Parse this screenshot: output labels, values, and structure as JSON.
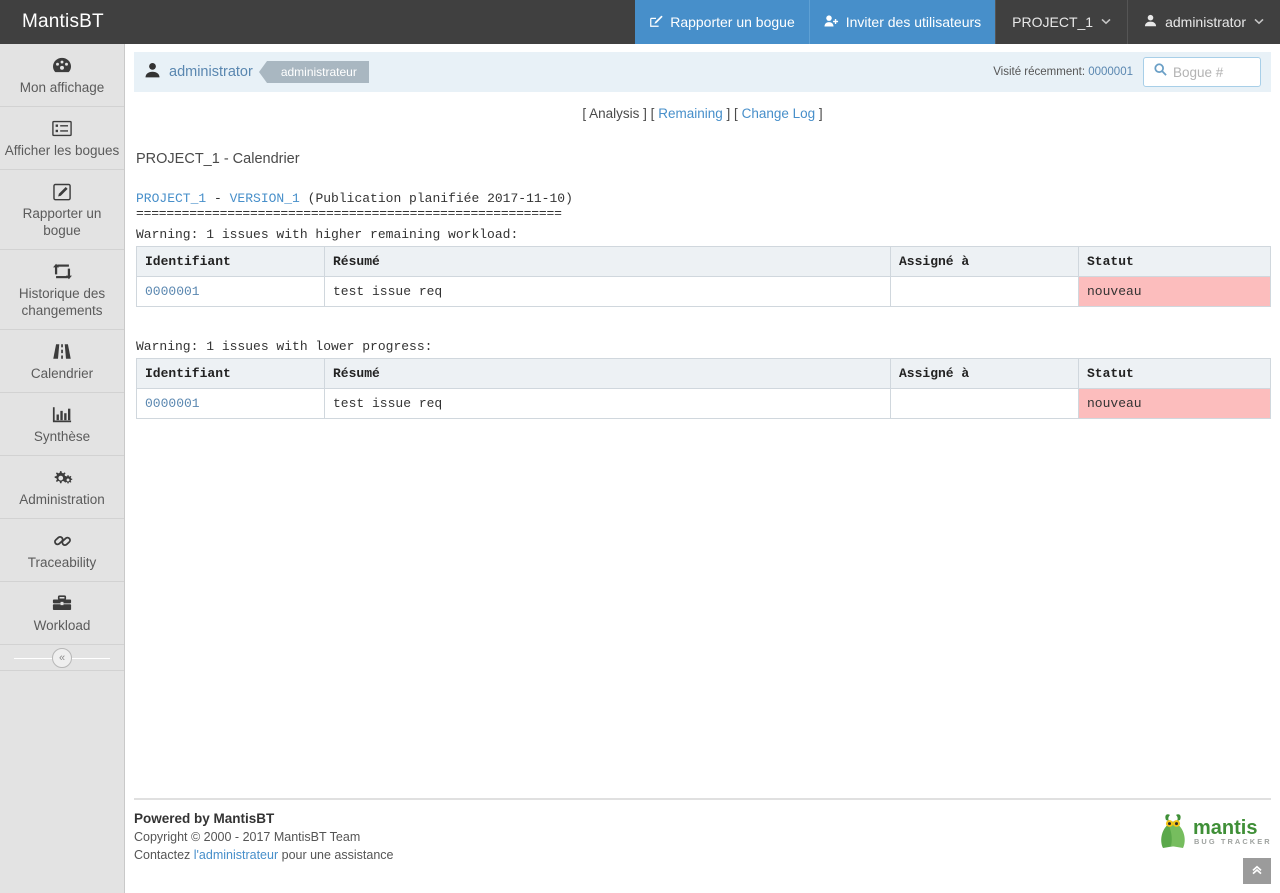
{
  "app": {
    "brand": "MantisBT"
  },
  "topbar": {
    "report_bug": "Rapporter un bogue",
    "invite_users": "Inviter des utilisateurs",
    "project": "PROJECT_1",
    "user": "administrator",
    "caret": "⌄"
  },
  "sidebar": {
    "items": [
      {
        "label": "Mon affichage",
        "icon": "dashboard-icon"
      },
      {
        "label": "Afficher les bogues",
        "icon": "list-icon"
      },
      {
        "label": "Rapporter un bogue",
        "icon": "edit-icon"
      },
      {
        "label": "Historique des changements",
        "icon": "retweet-icon"
      },
      {
        "label": "Calendrier",
        "icon": "road-icon"
      },
      {
        "label": "Synthèse",
        "icon": "bar-chart-icon"
      },
      {
        "label": "Administration",
        "icon": "gears-icon"
      },
      {
        "label": "Traceability",
        "icon": "link-icon"
      },
      {
        "label": "Workload",
        "icon": "briefcase-icon"
      }
    ],
    "collapse": "«"
  },
  "userbar": {
    "username": "administrator",
    "role_badge": "administrateur",
    "recent_label": "Visité récemment:",
    "recent_value": "0000001",
    "search_placeholder": "Bogue #",
    "search_value": ""
  },
  "toplinks": {
    "open": "[",
    "close": "]",
    "items": [
      {
        "label": "Analysis",
        "is_link": false
      },
      {
        "label": "Remaining",
        "is_link": true
      },
      {
        "label": "Change Log",
        "is_link": true
      }
    ]
  },
  "main": {
    "page_title": "PROJECT_1 - Calendrier",
    "version_project": "PROJECT_1",
    "version_dash": " - ",
    "version_name": "VERSION_1",
    "version_suffix": " (Publication planifiée 2017-11-10)",
    "separator": "========================================================",
    "columns": {
      "id": "Identifiant",
      "summary": "Résumé",
      "assigned": "Assigné à",
      "status": "Statut"
    },
    "sections": [
      {
        "warning": "Warning: 1 issues with higher remaining workload:",
        "rows": [
          {
            "id": "0000001",
            "summary": "test issue req",
            "assigned": "",
            "status": "nouveau"
          }
        ]
      },
      {
        "warning": "Warning: 1 issues with lower progress:",
        "rows": [
          {
            "id": "0000001",
            "summary": "test issue req",
            "assigned": "",
            "status": "nouveau"
          }
        ]
      }
    ]
  },
  "footer": {
    "powered_prefix": "Powered by ",
    "powered_link": "MantisBT",
    "copyright": "Copyright © 2000 - 2017 MantisBT Team",
    "contact_prefix": "Contactez ",
    "contact_link": "l'administrateur",
    "contact_suffix": " pour une assistance",
    "logo_text": "mantis",
    "logo_sub": "BUG TRACKER"
  },
  "scroll_top": {
    "glyph": "«"
  },
  "colors": {
    "header_bg": "#404040",
    "accent_blue": "#478fca",
    "link_blue": "#5a87b0",
    "status_new_bg": "#fcbdbd",
    "sidebar_bg": "#e3e3e3",
    "userbar_bg": "#e8f1f7"
  }
}
